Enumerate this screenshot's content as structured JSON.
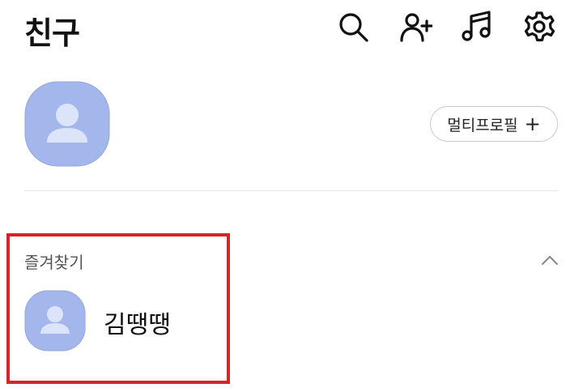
{
  "header": {
    "title": "친구",
    "icons": [
      "search-icon",
      "add-friend-icon",
      "music-icon",
      "settings-icon"
    ]
  },
  "my_profile": {
    "multi_profile_label": "멀티프로필",
    "multi_profile_plus": "+"
  },
  "favorites": {
    "label": "즐겨찾기",
    "toggle": "chevron-up-icon",
    "highlight_color": "#d8232a",
    "items": [
      {
        "name": "김땡땡"
      }
    ]
  },
  "colors": {
    "avatar_fill": "#a4b7ec",
    "avatar_silhouette": "#dbe4f8"
  }
}
